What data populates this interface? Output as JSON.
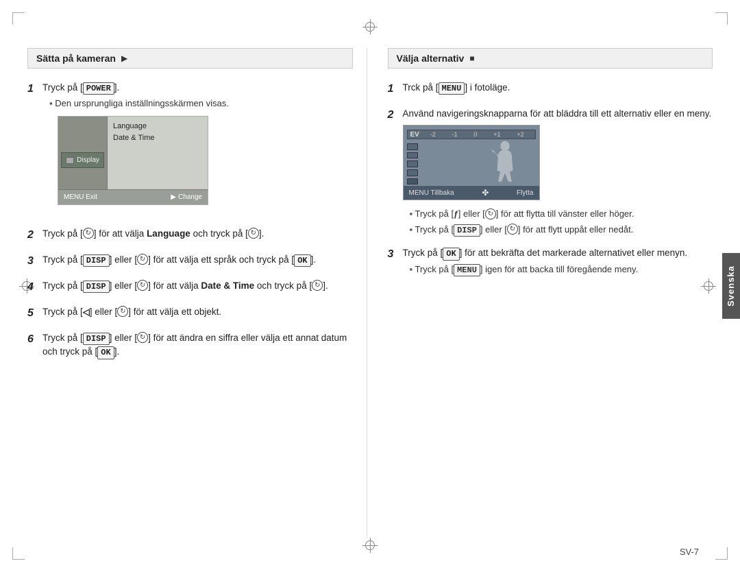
{
  "page": {
    "page_number": "SV-7"
  },
  "left_section": {
    "header": "Sätta på kameran",
    "intro_step": {
      "num": "1",
      "text": "Tryck på [POWER].",
      "sub": "Den ursprungliga inställningsskärmen visas."
    },
    "lcd": {
      "display_label": "Display",
      "menu_items": [
        "Language",
        "Date & Time"
      ],
      "bottom_left": "MENU Exit",
      "bottom_right": "Change"
    },
    "steps": [
      {
        "num": "2",
        "text": "Tryck på [ ] för att välja Language och tryck på [ ]."
      },
      {
        "num": "3",
        "text": "Tryck på [DISP] eller [ ] för att välja ett språk och tryck på [OK]."
      },
      {
        "num": "4",
        "text": "Tryck på [DISP] eller [ ] för att välja Date & Time och tryck på [ ]."
      },
      {
        "num": "5",
        "text": "Tryck på [ ] eller [ ] för att välja ett objekt."
      },
      {
        "num": "6",
        "text": "Tryck på [DISP] eller [ ] för att ändra en siffra eller välja ett annat datum och tryck på [OK]."
      }
    ]
  },
  "right_section": {
    "header": "Välja alternativ",
    "steps": [
      {
        "num": "1",
        "text": "Trck på [MENU] i fotoläge."
      },
      {
        "num": "2",
        "text": "Använd navigeringsknapparna för att bläddra till ett alternativ eller en meny.",
        "subs": [
          "Tryck på [ ] eller [ ] för att flytta till vänster eller höger.",
          "Tryck på [DISP] eller [ ] för att flytt uppåt eller nedåt."
        ]
      },
      {
        "num": "3",
        "text": "Tryck på [OK] för att bekräfta det markerade alternativet eller menyn.",
        "subs": [
          "Tryck på [MENU] igen för att backa till föregående meny."
        ]
      }
    ],
    "screen": {
      "ev_scale": [
        "-2",
        "-1",
        "0",
        "+1",
        "+2"
      ],
      "ev_label": "EV",
      "bottom_left": "MENU Tillbaka",
      "bottom_right": "Flytta"
    }
  },
  "side_tab": {
    "label": "Svenska"
  }
}
